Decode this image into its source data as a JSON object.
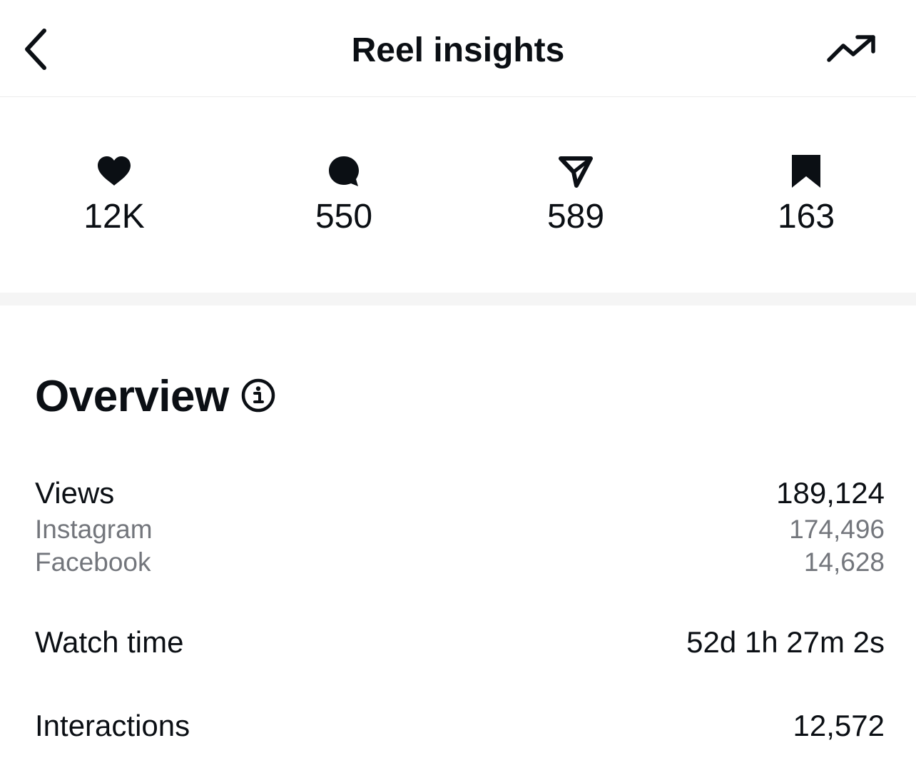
{
  "header": {
    "title": "Reel insights",
    "back_icon": "chevron-left-icon",
    "trend_icon": "trending-up-icon"
  },
  "stats": [
    {
      "icon": "heart-icon",
      "value": "12K"
    },
    {
      "icon": "comment-icon",
      "value": "550"
    },
    {
      "icon": "send-icon",
      "value": "589"
    },
    {
      "icon": "bookmark-icon",
      "value": "163"
    }
  ],
  "overview": {
    "title": "Overview",
    "info_icon": "info-icon",
    "views": {
      "label": "Views",
      "value": "189,124",
      "instagram_label": "Instagram",
      "instagram_value": "174,496",
      "facebook_label": "Facebook",
      "facebook_value": "14,628"
    },
    "watch_time": {
      "label": "Watch time",
      "value": "52d 1h 27m 2s"
    },
    "interactions": {
      "label": "Interactions",
      "value": "12,572"
    }
  },
  "colors": {
    "text_primary": "#0b0f14",
    "text_secondary": "#73767c",
    "divider": "#f5f5f5"
  }
}
